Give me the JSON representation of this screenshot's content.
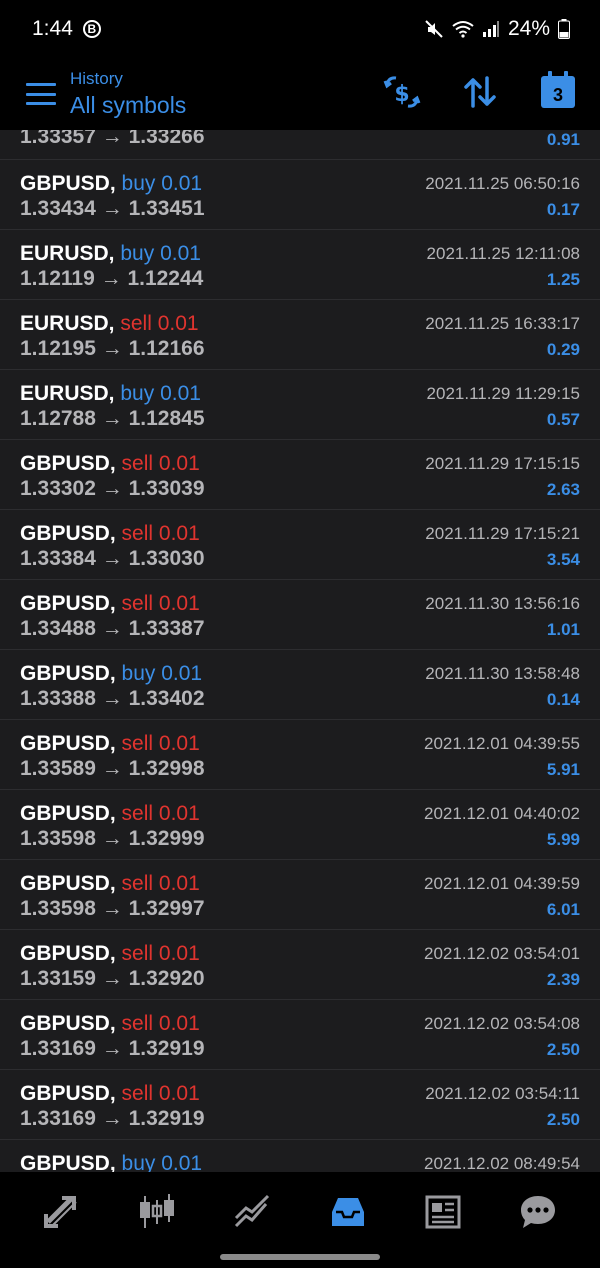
{
  "status_bar": {
    "time": "1:44",
    "badge": "B",
    "battery": "24%"
  },
  "header": {
    "subtitle": "History",
    "title": "All symbols",
    "calendar_day": "3"
  },
  "trades": [
    {
      "entry": "1.33357",
      "exit": "1.33266",
      "profit": "0.91",
      "partial": true
    },
    {
      "symbol": "GBPUSD,",
      "side": "buy",
      "volume": "0.01",
      "entry": "1.33434",
      "exit": "1.33451",
      "time": "2021.11.25 06:50:16",
      "profit": "0.17"
    },
    {
      "symbol": "EURUSD,",
      "side": "buy",
      "volume": "0.01",
      "entry": "1.12119",
      "exit": "1.12244",
      "time": "2021.11.25 12:11:08",
      "profit": "1.25"
    },
    {
      "symbol": "EURUSD,",
      "side": "sell",
      "volume": "0.01",
      "entry": "1.12195",
      "exit": "1.12166",
      "time": "2021.11.25 16:33:17",
      "profit": "0.29"
    },
    {
      "symbol": "EURUSD,",
      "side": "buy",
      "volume": "0.01",
      "entry": "1.12788",
      "exit": "1.12845",
      "time": "2021.11.29 11:29:15",
      "profit": "0.57"
    },
    {
      "symbol": "GBPUSD,",
      "side": "sell",
      "volume": "0.01",
      "entry": "1.33302",
      "exit": "1.33039",
      "time": "2021.11.29 17:15:15",
      "profit": "2.63"
    },
    {
      "symbol": "GBPUSD,",
      "side": "sell",
      "volume": "0.01",
      "entry": "1.33384",
      "exit": "1.33030",
      "time": "2021.11.29 17:15:21",
      "profit": "3.54"
    },
    {
      "symbol": "GBPUSD,",
      "side": "sell",
      "volume": "0.01",
      "entry": "1.33488",
      "exit": "1.33387",
      "time": "2021.11.30 13:56:16",
      "profit": "1.01"
    },
    {
      "symbol": "GBPUSD,",
      "side": "buy",
      "volume": "0.01",
      "entry": "1.33388",
      "exit": "1.33402",
      "time": "2021.11.30 13:58:48",
      "profit": "0.14"
    },
    {
      "symbol": "GBPUSD,",
      "side": "sell",
      "volume": "0.01",
      "entry": "1.33589",
      "exit": "1.32998",
      "time": "2021.12.01 04:39:55",
      "profit": "5.91"
    },
    {
      "symbol": "GBPUSD,",
      "side": "sell",
      "volume": "0.01",
      "entry": "1.33598",
      "exit": "1.32999",
      "time": "2021.12.01 04:40:02",
      "profit": "5.99"
    },
    {
      "symbol": "GBPUSD,",
      "side": "sell",
      "volume": "0.01",
      "entry": "1.33598",
      "exit": "1.32997",
      "time": "2021.12.01 04:39:59",
      "profit": "6.01"
    },
    {
      "symbol": "GBPUSD,",
      "side": "sell",
      "volume": "0.01",
      "entry": "1.33159",
      "exit": "1.32920",
      "time": "2021.12.02 03:54:01",
      "profit": "2.39"
    },
    {
      "symbol": "GBPUSD,",
      "side": "sell",
      "volume": "0.01",
      "entry": "1.33169",
      "exit": "1.32919",
      "time": "2021.12.02 03:54:08",
      "profit": "2.50"
    },
    {
      "symbol": "GBPUSD,",
      "side": "sell",
      "volume": "0.01",
      "entry": "1.33169",
      "exit": "1.32919",
      "time": "2021.12.02 03:54:11",
      "profit": "2.50"
    },
    {
      "symbol": "GBPUSD,",
      "side": "buy",
      "volume": "0.01",
      "entry": "",
      "exit": "",
      "time": "2021.12.02 08:49:54",
      "profit": ""
    }
  ],
  "colors": {
    "accent": "#3b8ee6",
    "sell": "#e0342f",
    "muted": "#b5b5b8",
    "list_bg": "#1c1c1e"
  },
  "bottom_nav": [
    {
      "icon": "trade-icon",
      "active": false
    },
    {
      "icon": "candlestick-chart-icon",
      "active": false
    },
    {
      "icon": "trend-chart-icon",
      "active": false
    },
    {
      "icon": "history-inbox-icon",
      "active": true
    },
    {
      "icon": "news-icon",
      "active": false
    },
    {
      "icon": "chat-icon",
      "active": false
    }
  ]
}
